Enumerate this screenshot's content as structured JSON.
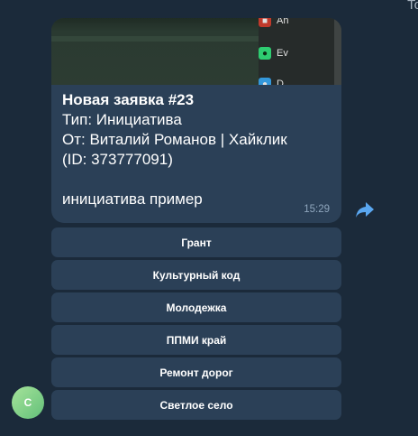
{
  "corner_text": "To",
  "message": {
    "media": {
      "apps": [
        {
          "label": "An",
          "icon": "red-app-icon"
        },
        {
          "label": "Ev",
          "icon": "evernote-icon"
        },
        {
          "label": "D",
          "icon": "blue-app-icon"
        }
      ]
    },
    "lines": [
      "Новая заявка #23",
      "Тип: Инициатива",
      "От: Виталий Романов | Хайклик",
      "(ID: 373777091)",
      "инициатива пример"
    ],
    "time": "15:29"
  },
  "buttons": [
    "Грант",
    "Культурный код",
    "Молодежка",
    "ППМИ край",
    "Ремонт дорог",
    "Светлое село"
  ],
  "avatar_letter": "С",
  "colors": {
    "background": "#1b2a3a",
    "bubble": "#2b4057",
    "accent": "#5aa7f0",
    "time": "#8fa6bd"
  }
}
